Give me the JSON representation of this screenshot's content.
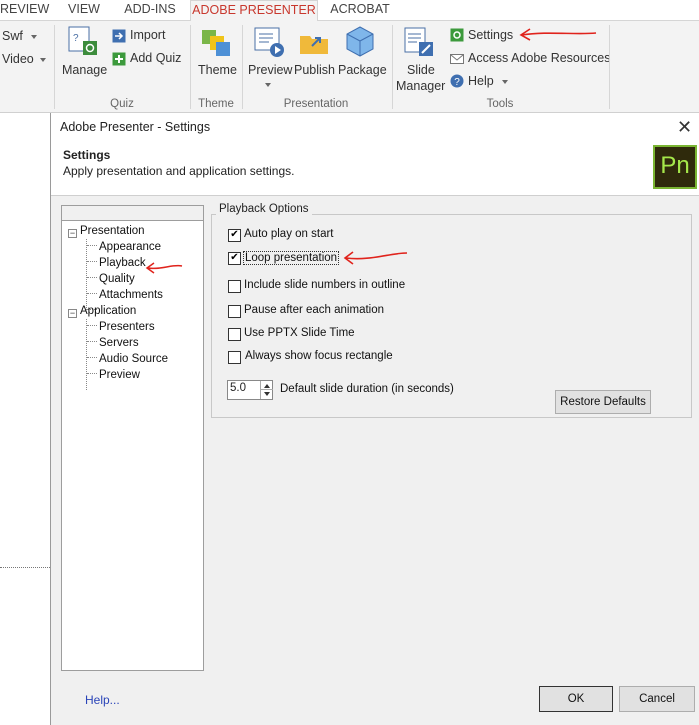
{
  "ribbon": {
    "tabs": [
      "REVIEW",
      "VIEW",
      "ADD-INS",
      "ADOBE PRESENTER",
      "ACROBAT"
    ],
    "active_tab": "ADOBE PRESENTER",
    "left_items": {
      "swf": "Swf",
      "video": "Video"
    },
    "quiz": {
      "manage": "Manage",
      "import": "Import",
      "add_quiz": "Add Quiz",
      "group": "Quiz"
    },
    "theme": {
      "theme": "Theme",
      "group": "Theme"
    },
    "presentation": {
      "preview": "Preview",
      "publish": "Publish",
      "package": "Package",
      "group": "Presentation"
    },
    "tools": {
      "slide_manager_1": "Slide",
      "slide_manager_2": "Manager",
      "settings": "Settings",
      "access": "Access Adobe Resources",
      "help": "Help",
      "group": "Tools"
    }
  },
  "dialog": {
    "title": "Adobe Presenter - Settings",
    "close": "✕",
    "header_title": "Settings",
    "header_subtitle": "Apply presentation and application settings.",
    "logo_text": "Pn",
    "tree": {
      "presentation": "Presentation",
      "presentation_children": [
        "Appearance",
        "Playback",
        "Quality",
        "Attachments"
      ],
      "application": "Application",
      "application_children": [
        "Presenters",
        "Servers",
        "Audio Source",
        "Preview"
      ]
    },
    "playback": {
      "legend": "Playback Options",
      "options": [
        {
          "label": "Auto play on start",
          "checked": true
        },
        {
          "label": "Loop presentation",
          "checked": true
        },
        {
          "label": "Include slide numbers in outline",
          "checked": false
        },
        {
          "label": "Pause after each animation",
          "checked": false
        },
        {
          "label": "Use PPTX  Slide Time",
          "checked": false
        },
        {
          "label": "Always show focus rectangle",
          "checked": false
        }
      ],
      "duration_value": "5.0",
      "duration_label": "Default slide duration (in seconds)",
      "restore_defaults": "Restore Defaults"
    },
    "help": "Help...",
    "ok": "OK",
    "cancel": "Cancel"
  },
  "colors": {
    "accent_tab": "#c8372d",
    "annotation": "#e0231c",
    "link": "#2a44b8"
  }
}
